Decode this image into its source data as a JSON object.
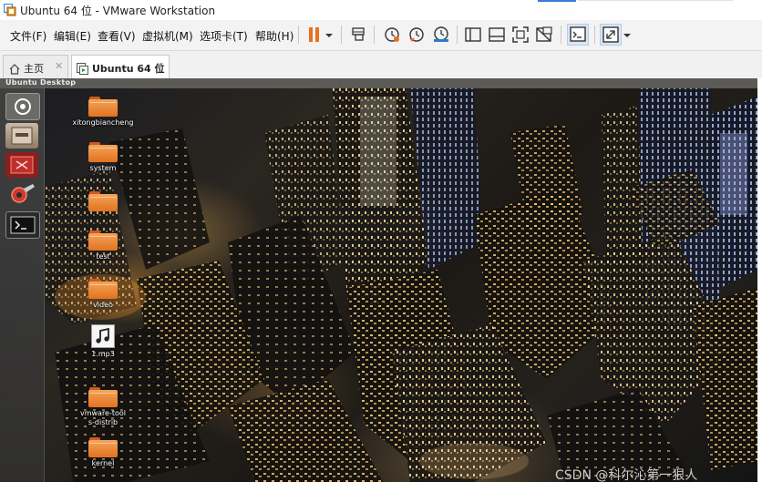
{
  "window": {
    "title": "Ubuntu 64 位 - VMware Workstation"
  },
  "menu": [
    "文件(F)",
    "编辑(E)",
    "查看(V)",
    "虚拟机(M)",
    "选项卡(T)",
    "帮助(H)"
  ],
  "toolbar": {
    "icons": [
      "pause-icon",
      "dropdown-arrow-icon",
      "send-keys-icon",
      "snapshot-icon",
      "revert-snapshot-icon",
      "snapshot-manager-icon",
      "library-icon",
      "thumbnail-icon",
      "full-screen-icon",
      "unity-icon",
      "console-icon",
      "stretch-icon",
      "dropdown-arrow-icon"
    ],
    "pause_color": "#e8711f"
  },
  "tabs": [
    {
      "label": "主页",
      "active": false
    },
    {
      "label": "Ubuntu 64 位",
      "active": true
    }
  ],
  "vm": {
    "header": "Ubuntu Desktop",
    "launcher": [
      "dash-home-icon",
      "files-icon",
      "terminal-red-icon",
      "system-settings-icon",
      "terminal-icon"
    ],
    "desktop_items": [
      {
        "label": "xitongbiancheng",
        "type": "folder"
      },
      {
        "label": "system",
        "type": "folder"
      },
      {
        "label": "",
        "type": "folder"
      },
      {
        "label": "test",
        "type": "folder"
      },
      {
        "label": "video",
        "type": "folder"
      },
      {
        "label": "1.mp3",
        "type": "audio"
      },
      {
        "label": "vmware-tools-distrib",
        "type": "folder"
      },
      {
        "label": "kernel",
        "type": "folder"
      }
    ]
  },
  "watermark": "CSDN @科尔沁第一狠人"
}
